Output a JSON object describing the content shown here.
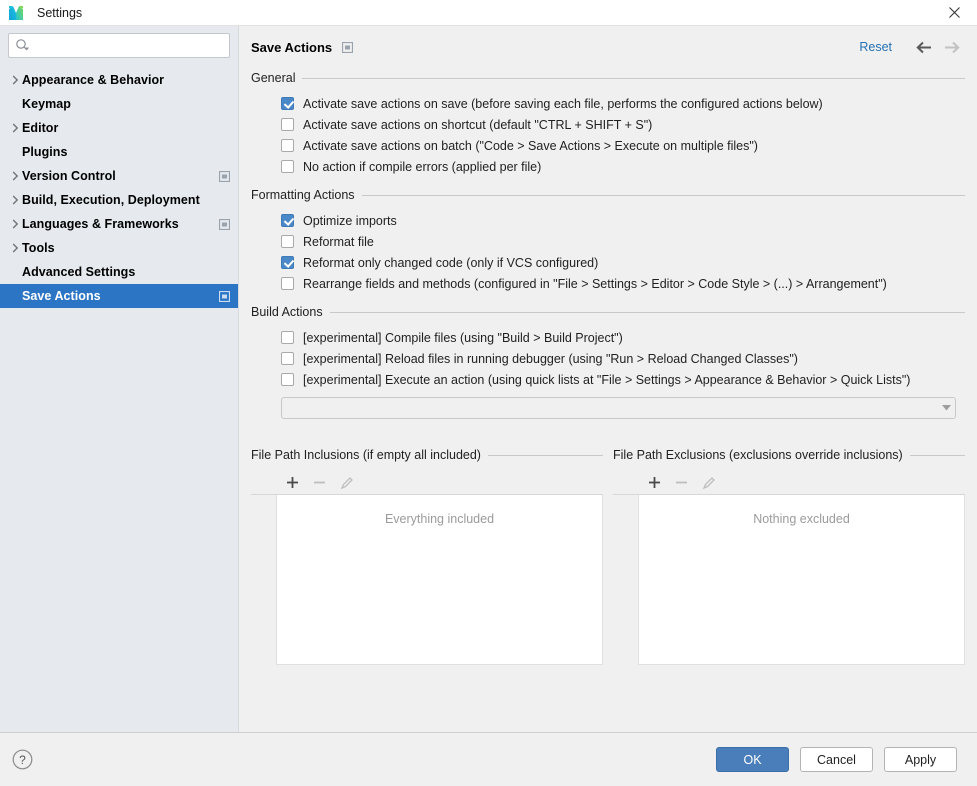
{
  "window": {
    "title": "Settings",
    "logo_icon": "intellij-logo-icon",
    "close_icon": "close-icon"
  },
  "sidebar": {
    "search": {
      "placeholder": "",
      "value": "",
      "icon": "search-icon"
    },
    "items": [
      {
        "label": "Appearance & Behavior",
        "expandable": true,
        "badge": false,
        "selected": false
      },
      {
        "label": "Keymap",
        "expandable": false,
        "badge": false,
        "selected": false
      },
      {
        "label": "Editor",
        "expandable": true,
        "badge": false,
        "selected": false
      },
      {
        "label": "Plugins",
        "expandable": false,
        "badge": false,
        "selected": false
      },
      {
        "label": "Version Control",
        "expandable": true,
        "badge": true,
        "selected": false
      },
      {
        "label": "Build, Execution, Deployment",
        "expandable": true,
        "badge": false,
        "selected": false
      },
      {
        "label": "Languages & Frameworks",
        "expandable": true,
        "badge": true,
        "selected": false
      },
      {
        "label": "Tools",
        "expandable": true,
        "badge": false,
        "selected": false
      },
      {
        "label": "Advanced Settings",
        "expandable": false,
        "badge": false,
        "selected": false
      },
      {
        "label": "Save Actions",
        "expandable": false,
        "badge": true,
        "selected": true
      }
    ]
  },
  "header": {
    "title": "Save Actions",
    "title_badge_icon": "panel-badge-icon",
    "reset_label": "Reset",
    "back_icon": "arrow-left-icon",
    "forward_icon": "arrow-right-icon"
  },
  "sections": [
    {
      "title": "General",
      "checkboxes": [
        {
          "label": "Activate save actions on save (before saving each file, performs the configured actions below)",
          "checked": true
        },
        {
          "label": "Activate save actions on shortcut (default \"CTRL + SHIFT + S\")",
          "checked": false
        },
        {
          "label": "Activate save actions on batch (\"Code > Save Actions > Execute on multiple files\")",
          "checked": false
        },
        {
          "label": "No action if compile errors (applied per file)",
          "checked": false
        }
      ]
    },
    {
      "title": "Formatting Actions",
      "checkboxes": [
        {
          "label": "Optimize imports",
          "checked": true
        },
        {
          "label": "Reformat file",
          "checked": false
        },
        {
          "label": "Reformat only changed code (only if VCS configured)",
          "checked": true
        },
        {
          "label": "Rearrange fields and methods (configured in \"File > Settings > Editor > Code Style > (...) > Arrangement\")",
          "checked": false
        }
      ]
    },
    {
      "title": "Build Actions",
      "checkboxes": [
        {
          "label": "[experimental] Compile files (using \"Build > Build Project\")",
          "checked": false
        },
        {
          "label": "[experimental] Reload files in running debugger (using \"Run > Reload Changed Classes\")",
          "checked": false
        },
        {
          "label": "[experimental] Execute an action (using quick lists at \"File > Settings > Appearance & Behavior > Quick Lists\")",
          "checked": false
        }
      ]
    }
  ],
  "quick_list_combo": {
    "value": "",
    "arrow_icon": "chevron-down-icon"
  },
  "path_panels": [
    {
      "title": "File Path Inclusions (if empty all included)",
      "empty_text": "Everything included",
      "tools": [
        {
          "icon": "plus-icon",
          "enabled": true
        },
        {
          "icon": "minus-icon",
          "enabled": false
        },
        {
          "icon": "pencil-icon",
          "enabled": false
        }
      ]
    },
    {
      "title": "File Path Exclusions (exclusions override inclusions)",
      "empty_text": "Nothing excluded",
      "tools": [
        {
          "icon": "plus-icon",
          "enabled": true
        },
        {
          "icon": "minus-icon",
          "enabled": false
        },
        {
          "icon": "pencil-icon",
          "enabled": false
        }
      ]
    }
  ],
  "footer": {
    "help_icon": "help-icon",
    "ok_label": "OK",
    "cancel_label": "Cancel",
    "apply_label": "Apply"
  },
  "colors": {
    "accent": "#4a7ebb",
    "selection": "#2b75c4",
    "link": "#2470b3",
    "checkbox_checked": "#4a88c7",
    "sidebar_bg": "#e6eaee",
    "panel_bg": "#f0f0f0"
  }
}
